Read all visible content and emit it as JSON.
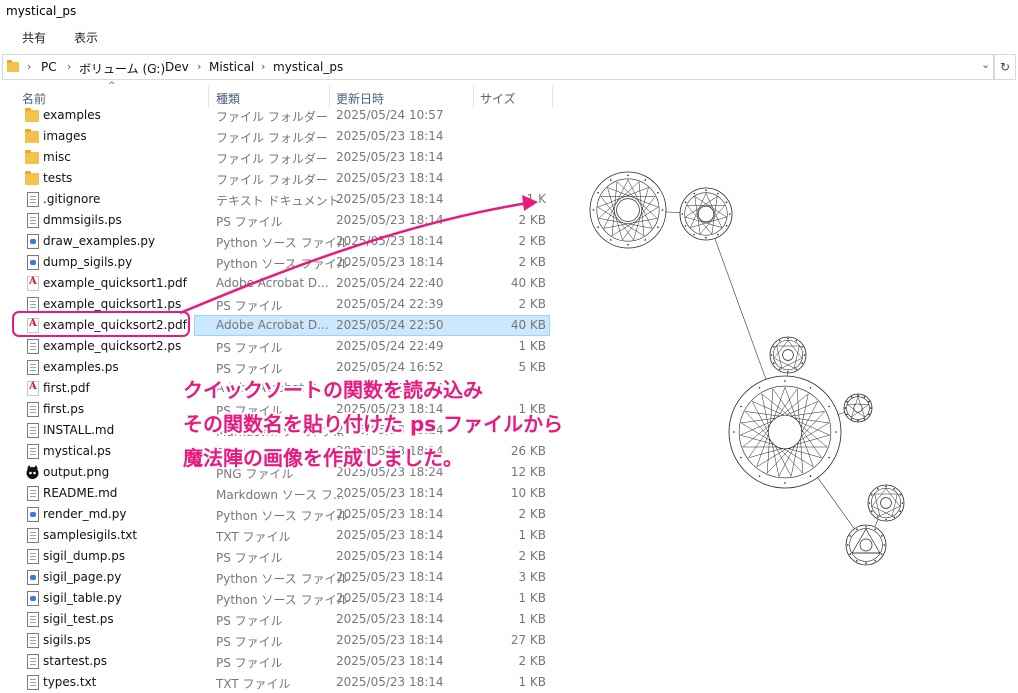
{
  "window": {
    "title": "mystical_ps"
  },
  "ribbon": {
    "tabs": [
      "共有",
      "表示"
    ]
  },
  "address": {
    "crumbs": [
      "PC",
      "ボリューム (G:)",
      "Dev",
      "Mistical",
      "mystical_ps"
    ]
  },
  "columns": {
    "name": "名前",
    "type": "種類",
    "date": "更新日時",
    "size": "サイズ"
  },
  "files": [
    {
      "name": "examples",
      "type": "ファイル フォルダー",
      "date": "2025/05/24 10:57",
      "size": "",
      "icon": "folder"
    },
    {
      "name": "images",
      "type": "ファイル フォルダー",
      "date": "2025/05/23 18:14",
      "size": "",
      "icon": "folder"
    },
    {
      "name": "misc",
      "type": "ファイル フォルダー",
      "date": "2025/05/23 18:14",
      "size": "",
      "icon": "folder"
    },
    {
      "name": "tests",
      "type": "ファイル フォルダー",
      "date": "2025/05/23 18:14",
      "size": "",
      "icon": "folder"
    },
    {
      "name": ".gitignore",
      "type": "テキスト ドキュメント",
      "date": "2025/05/23 18:14",
      "size": "1 K",
      "icon": "doc"
    },
    {
      "name": "dmmsigils.ps",
      "type": "PS ファイル",
      "date": "2025/05/23 18:14",
      "size": "2 KB",
      "icon": "doc"
    },
    {
      "name": "draw_examples.py",
      "type": "Python ソース ファイル",
      "date": "2025/05/23 18:14",
      "size": "2 KB",
      "icon": "py"
    },
    {
      "name": "dump_sigils.py",
      "type": "Python ソース ファイル",
      "date": "2025/05/23 18:14",
      "size": "2 KB",
      "icon": "py"
    },
    {
      "name": "example_quicksort1.pdf",
      "type": "Adobe Acrobat D...",
      "date": "2025/05/24 22:40",
      "size": "40 KB",
      "icon": "pdf"
    },
    {
      "name": "example_quicksort1.ps",
      "type": "PS ファイル",
      "date": "2025/05/24 22:39",
      "size": "2 KB",
      "icon": "doc"
    },
    {
      "name": "example_quicksort2.pdf",
      "type": "Adobe Acrobat D...",
      "date": "2025/05/24 22:50",
      "size": "40 KB",
      "icon": "pdf",
      "selected": true
    },
    {
      "name": "example_quicksort2.ps",
      "type": "PS ファイル",
      "date": "2025/05/24 22:49",
      "size": "1 KB",
      "icon": "doc"
    },
    {
      "name": "examples.ps",
      "type": "PS ファイル",
      "date": "2025/05/24 16:52",
      "size": "5 KB",
      "icon": "doc"
    },
    {
      "name": "first.pdf",
      "type": "Adobe Acrobat D...",
      "date": "2025/05/23 18:14",
      "size": "",
      "icon": "pdf"
    },
    {
      "name": "first.ps",
      "type": "PS ファイル",
      "date": "2025/05/23 18:14",
      "size": "1 KB",
      "icon": "doc"
    },
    {
      "name": "INSTALL.md",
      "type": "Markdown ソース フ...",
      "date": "2025/05/23 18:14",
      "size": "",
      "icon": "doc"
    },
    {
      "name": "mystical.ps",
      "type": "PS ファイル",
      "date": "2025/05/23 18:14",
      "size": "26 KB",
      "icon": "doc"
    },
    {
      "name": "output.png",
      "type": "PNG ファイル",
      "date": "2025/05/23 18:24",
      "size": "12 KB",
      "icon": "png"
    },
    {
      "name": "README.md",
      "type": "Markdown ソース フ...",
      "date": "2025/05/23 18:14",
      "size": "10 KB",
      "icon": "doc"
    },
    {
      "name": "render_md.py",
      "type": "Python ソース ファイル",
      "date": "2025/05/23 18:14",
      "size": "2 KB",
      "icon": "py"
    },
    {
      "name": "samplesigils.txt",
      "type": "TXT ファイル",
      "date": "2025/05/23 18:14",
      "size": "1 KB",
      "icon": "doc"
    },
    {
      "name": "sigil_dump.ps",
      "type": "PS ファイル",
      "date": "2025/05/23 18:14",
      "size": "2 KB",
      "icon": "doc"
    },
    {
      "name": "sigil_page.py",
      "type": "Python ソース ファイル",
      "date": "2025/05/23 18:14",
      "size": "3 KB",
      "icon": "py"
    },
    {
      "name": "sigil_table.py",
      "type": "Python ソース ファイル",
      "date": "2025/05/23 18:14",
      "size": "1 KB",
      "icon": "py"
    },
    {
      "name": "sigil_test.ps",
      "type": "PS ファイル",
      "date": "2025/05/23 18:14",
      "size": "1 KB",
      "icon": "doc"
    },
    {
      "name": "sigils.ps",
      "type": "PS ファイル",
      "date": "2025/05/23 18:14",
      "size": "27 KB",
      "icon": "doc"
    },
    {
      "name": "startest.ps",
      "type": "PS ファイル",
      "date": "2025/05/23 18:14",
      "size": "2 KB",
      "icon": "doc"
    },
    {
      "name": "types.txt",
      "type": "TXT ファイル",
      "date": "2025/05/23 18:14",
      "size": "1 KB",
      "icon": "doc"
    }
  ],
  "annotation": {
    "lines": [
      "クイックソートの関数を読み込み",
      "その関数名を貼り付けた ps ファイルから",
      "魔法陣の画像を作成しました。"
    ],
    "color": "#e8197f"
  },
  "colors": {
    "selection": "#cce8ff",
    "accent": "#e8197f"
  }
}
